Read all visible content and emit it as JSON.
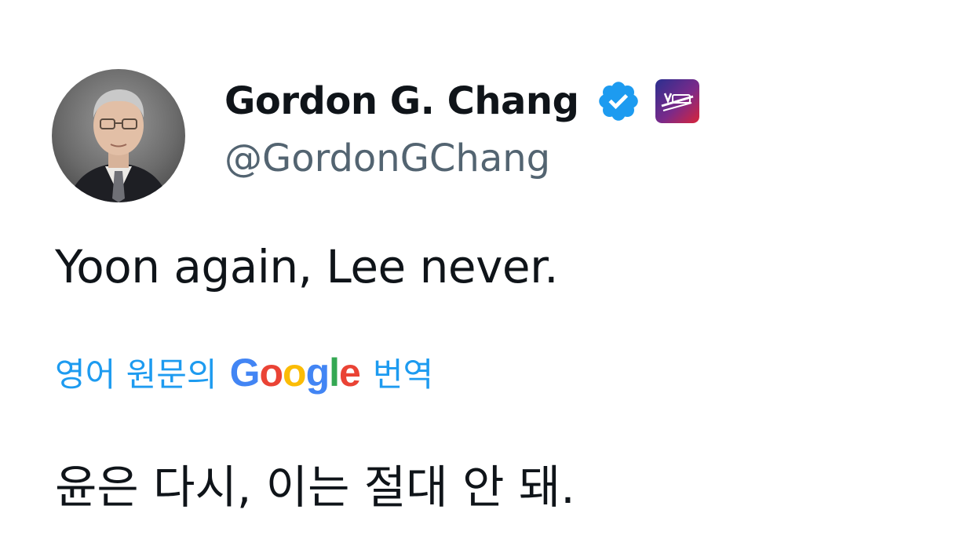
{
  "author": {
    "display_name": "Gordon G. Chang",
    "handle": "@GordonGChang",
    "avatar": "avatar-photo",
    "verified_icon": "verified-badge-icon",
    "affiliation_icon": "affiliation-badge-icon"
  },
  "tweet": {
    "text": "Yoon again, Lee never.",
    "translation_prefix": "영어 원문의",
    "translation_brand": "Google",
    "translation_suffix": "번역",
    "translated_text": "윤은 다시, 이는 절대 안 돼."
  },
  "colors": {
    "text_primary": "#0f1419",
    "text_secondary": "#536471",
    "link_blue": "#1d9bf0",
    "verified_blue": "#1d9bf0",
    "google_blue": "#4285f4",
    "google_red": "#ea4335",
    "google_yellow": "#fbbc05",
    "google_green": "#34a853"
  }
}
